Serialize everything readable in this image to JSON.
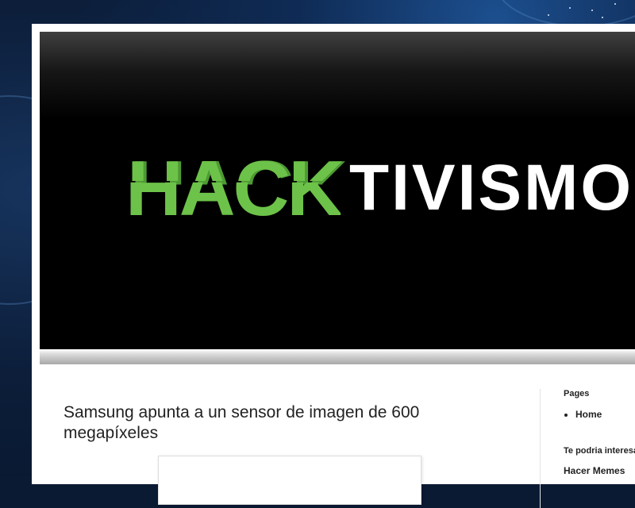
{
  "header": {
    "logo_part1": "HACK",
    "logo_part2": "TIVISMO",
    "colors": {
      "hack_green": "#6dc249",
      "header_bg": "#000000",
      "logo_white": "#ffffff"
    }
  },
  "post": {
    "title": "Samsung apunta a un sensor de imagen de 600 megapíxeles"
  },
  "sidebar": {
    "pages_title": "Pages",
    "pages": [
      {
        "label": "Home"
      }
    ],
    "interest_title": "Te podria interesar",
    "interest_items": [
      {
        "label": "Hacer Memes"
      }
    ]
  }
}
